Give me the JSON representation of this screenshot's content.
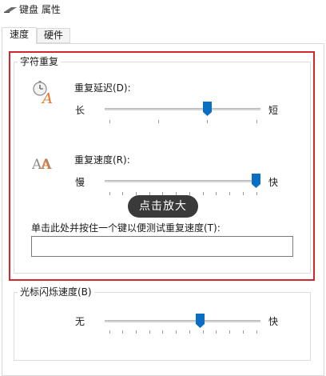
{
  "window": {
    "title": "键盘 属性",
    "title_icon": "keyboard-icon"
  },
  "tabs": [
    {
      "label": "速度",
      "active": true
    },
    {
      "label": "硬件",
      "active": false
    }
  ],
  "character_repeat": {
    "group_title": "字符重复",
    "repeat_delay": {
      "label": "重复延迟(D):",
      "icon": "stopwatch-letter-icon",
      "min_label": "长",
      "max_label": "短",
      "tick_count": 4,
      "value_fraction": 0.67
    },
    "repeat_rate": {
      "label": "重复速度(R):",
      "icon": "repeated-letters-icon",
      "icon_text": "AA",
      "min_label": "慢",
      "max_label": "快",
      "tick_count": 12,
      "value_fraction": 1.0
    },
    "test_label": "单击此处并按住一个键以便测试重复速度(T):",
    "test_value": ""
  },
  "cursor_blink": {
    "group_title": "光标闪烁速度(B)",
    "min_label": "无",
    "max_label": "快",
    "value_fraction": 0.62
  },
  "overlay": {
    "zoom_tip": "点击放大"
  },
  "colors": {
    "accent": "#0a6fc2",
    "highlight_border": "#d5252d",
    "tooltip_bg": "#3a3a3a",
    "icon_orange": "#e3762a"
  }
}
